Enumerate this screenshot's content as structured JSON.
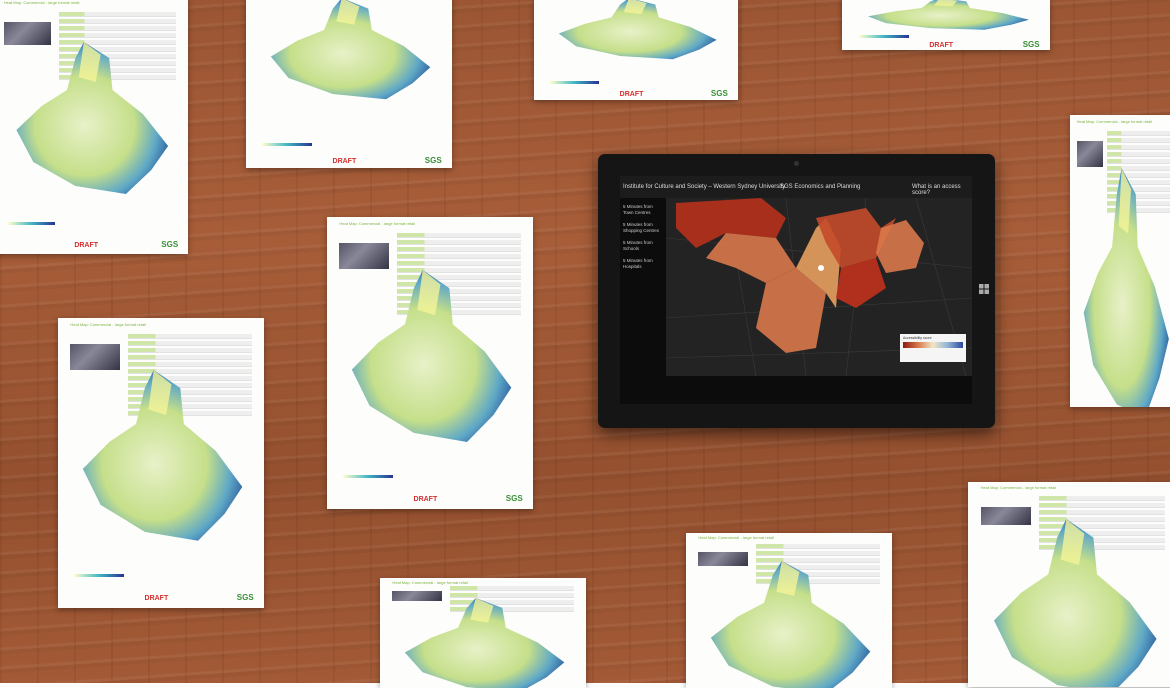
{
  "scene": {
    "description_colors": {
      "desk": "#a35a36",
      "heat_low": "#ffffcc",
      "heat_high": "#253494",
      "draft_red": "#d32f2f",
      "sgs_green": "#3a8f3a"
    }
  },
  "sheets": {
    "header": "Heat Map: Commercial - large format retail",
    "draft": "DRAFT",
    "logo": "SGS"
  },
  "tablet": {
    "app_title": "Institute for Culture and Society – Western Sydney University",
    "firm": "SGS Economics and Planning",
    "search_hint": "What is an access score?",
    "sidebar": [
      "5 Minutes from Town Centres",
      "5 Minutes from Shopping Centres",
      "5 Minutes from Schools",
      "5 Minutes from Hospitals"
    ],
    "legend_title": "Accessibility score",
    "colors": {
      "hot": "#b8311d",
      "mid": "#d9784a",
      "warm": "#e8a05e"
    }
  }
}
